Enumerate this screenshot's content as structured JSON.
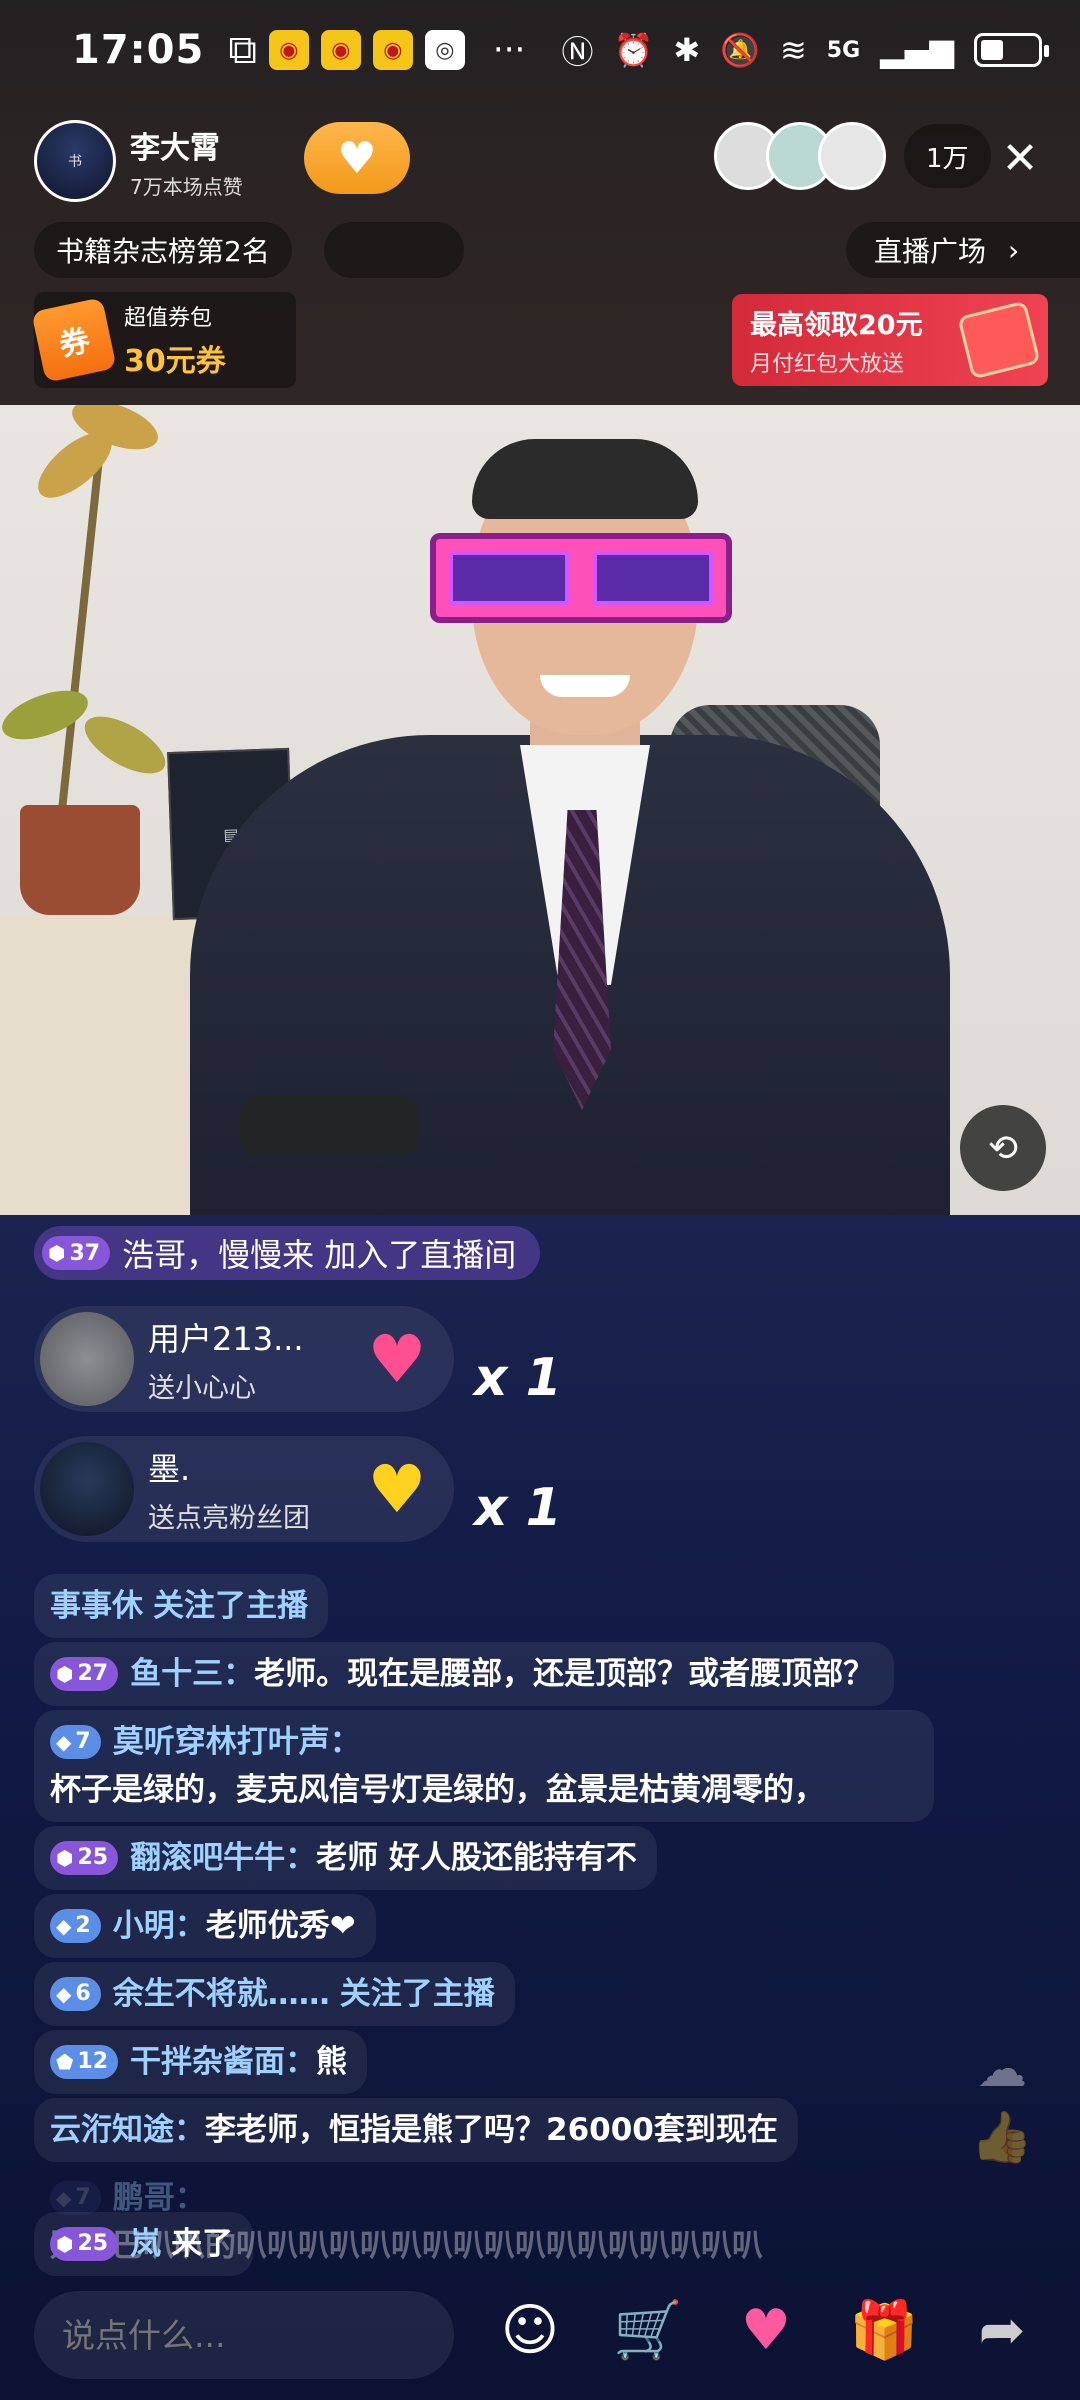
{
  "status_bar": {
    "time": "17:05",
    "more": "···",
    "network": "5G"
  },
  "host": {
    "name": "李大霄",
    "likes": "7万本场点赞",
    "viewer_count": "1万",
    "rank": "书籍杂志榜第2名",
    "rank_secondary": "",
    "live_plaza": "直播广场"
  },
  "coupon": {
    "icon_text": "券",
    "title": "超值券包",
    "value": "30元券"
  },
  "red_packet": {
    "title": "最高领取20元",
    "subtitle": "月付红包大放送"
  },
  "join_banner": {
    "level": "37",
    "text": "浩哥，慢慢来 加入了直播间"
  },
  "gifts": [
    {
      "user": "用户213...",
      "desc": "送小心心",
      "count": "x 1",
      "icon": "pink-heart-icon"
    },
    {
      "user": "墨.",
      "desc": "送点亮粉丝团",
      "count": "x 1",
      "icon": "gold-heart-icon"
    }
  ],
  "messages": [
    {
      "level": "",
      "user": "事事休",
      "text": "关注了主播",
      "system": true
    },
    {
      "level": "27",
      "user": "鱼十三：",
      "text": "老师。现在是腰部，还是顶部？或者腰顶部？"
    },
    {
      "level": "7",
      "user": "莫听穿林打叶声：",
      "text": "杯子是绿的，麦克风信号灯是绿的，盆景是枯黄凋零的，"
    },
    {
      "level": "25",
      "user": "翻滚吧牛牛：",
      "text": "老师 好人股还能持有不"
    },
    {
      "level": "2",
      "user": "小明：",
      "text": "老师优秀❤"
    },
    {
      "level": "6",
      "user": "余生不将就……",
      "text": "关注了主播",
      "system": true
    },
    {
      "level": "12",
      "user": "干拌杂酱面：",
      "text": "熊"
    },
    {
      "level": "",
      "user": "云洐知途：",
      "text": "李老师，恒指是熊了吗？26000套到现在"
    },
    {
      "level": "7",
      "user": "鹏哥：",
      "text": "别巴巴叭叭的叭叭叭叭叭叭叭叭叭叭叭叭叭叭叭叭叭"
    },
    {
      "level": "25",
      "user": "岚",
      "text": "来了"
    }
  ],
  "bottom_bar": {
    "input_placeholder": "说点什么..."
  },
  "colors": {
    "accent_gold": "#ffc23a",
    "username_blue": "#9fd1ff",
    "level_purple": "#8856d8",
    "red_packet": "#e23646"
  }
}
